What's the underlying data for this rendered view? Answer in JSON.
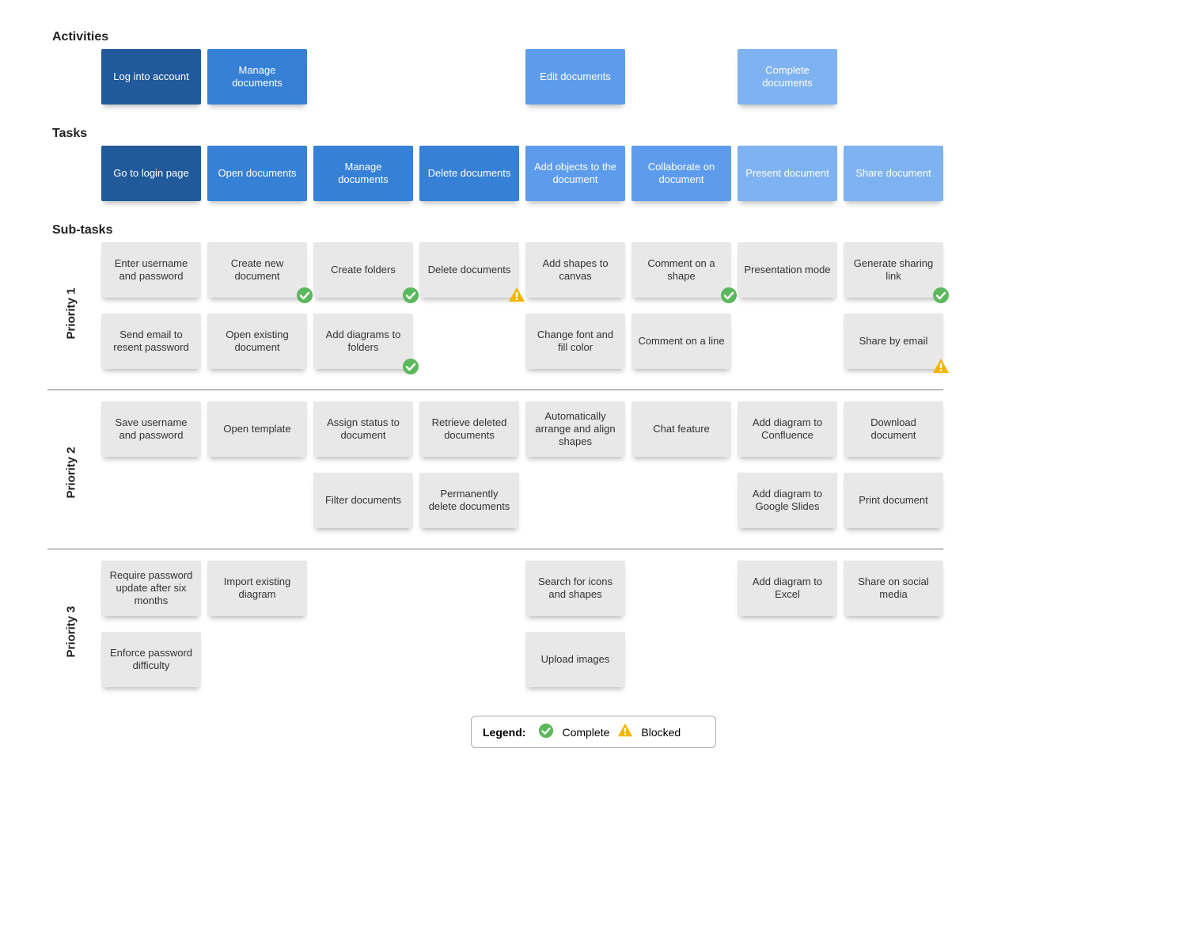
{
  "headings": {
    "activities": "Activities",
    "tasks": "Tasks",
    "subtasks": "Sub-tasks",
    "priority1": "Priority 1",
    "priority2": "Priority 2",
    "priority3": "Priority 3"
  },
  "activities": [
    {
      "text": "Log into account",
      "shade": "d"
    },
    {
      "text": "Manage documents",
      "shade": "m"
    },
    {
      "text": "",
      "shade": ""
    },
    {
      "text": "",
      "shade": ""
    },
    {
      "text": "Edit documents",
      "shade": "l"
    },
    {
      "text": "",
      "shade": ""
    },
    {
      "text": "Complete documents",
      "shade": "xl"
    },
    {
      "text": "",
      "shade": ""
    }
  ],
  "tasks": [
    {
      "text": "Go to login page",
      "shade": "d"
    },
    {
      "text": "Open documents",
      "shade": "m"
    },
    {
      "text": "Manage documents",
      "shade": "m"
    },
    {
      "text": "Delete documents",
      "shade": "m"
    },
    {
      "text": "Add objects to the document",
      "shade": "l"
    },
    {
      "text": "Collaborate on document",
      "shade": "l"
    },
    {
      "text": "Present document",
      "shade": "xl"
    },
    {
      "text": "Share document",
      "shade": "xl"
    }
  ],
  "priority1": [
    [
      {
        "text": "Enter username and password"
      },
      {
        "text": "Create new document",
        "status": "complete"
      },
      {
        "text": "Create folders",
        "status": "complete"
      },
      {
        "text": "Delete documents",
        "status": "blocked"
      },
      {
        "text": "Add shapes to canvas"
      },
      {
        "text": "Comment on a shape",
        "status": "complete"
      },
      {
        "text": "Presentation mode"
      },
      {
        "text": "Generate sharing link",
        "status": "complete"
      }
    ],
    [
      {
        "text": "Send email to resent password"
      },
      {
        "text": "Open existing document"
      },
      {
        "text": "Add diagrams to folders",
        "status": "complete"
      },
      {
        "text": ""
      },
      {
        "text": "Change font and fill color"
      },
      {
        "text": "Comment on a line"
      },
      {
        "text": ""
      },
      {
        "text": "Share by email",
        "status": "blocked"
      }
    ]
  ],
  "priority2": [
    [
      {
        "text": "Save username and password"
      },
      {
        "text": "Open template"
      },
      {
        "text": "Assign status to document"
      },
      {
        "text": "Retrieve deleted documents"
      },
      {
        "text": "Automatically arrange and align shapes"
      },
      {
        "text": "Chat feature"
      },
      {
        "text": "Add diagram to Confluence"
      },
      {
        "text": "Download document"
      }
    ],
    [
      {
        "text": ""
      },
      {
        "text": ""
      },
      {
        "text": "Filter documents"
      },
      {
        "text": "Permanently delete documents"
      },
      {
        "text": ""
      },
      {
        "text": ""
      },
      {
        "text": "Add diagram to Google Slides"
      },
      {
        "text": "Print document"
      }
    ]
  ],
  "priority3": [
    [
      {
        "text": "Require password update after six months"
      },
      {
        "text": "Import existing diagram"
      },
      {
        "text": ""
      },
      {
        "text": ""
      },
      {
        "text": "Search for icons and shapes"
      },
      {
        "text": ""
      },
      {
        "text": "Add diagram to Excel"
      },
      {
        "text": "Share on social media"
      }
    ],
    [
      {
        "text": "Enforce password difficulty"
      },
      {
        "text": ""
      },
      {
        "text": ""
      },
      {
        "text": ""
      },
      {
        "text": "Upload images"
      },
      {
        "text": ""
      },
      {
        "text": ""
      },
      {
        "text": ""
      }
    ]
  ],
  "legend": {
    "title": "Legend:",
    "complete": "Complete",
    "blocked": "Blocked"
  }
}
